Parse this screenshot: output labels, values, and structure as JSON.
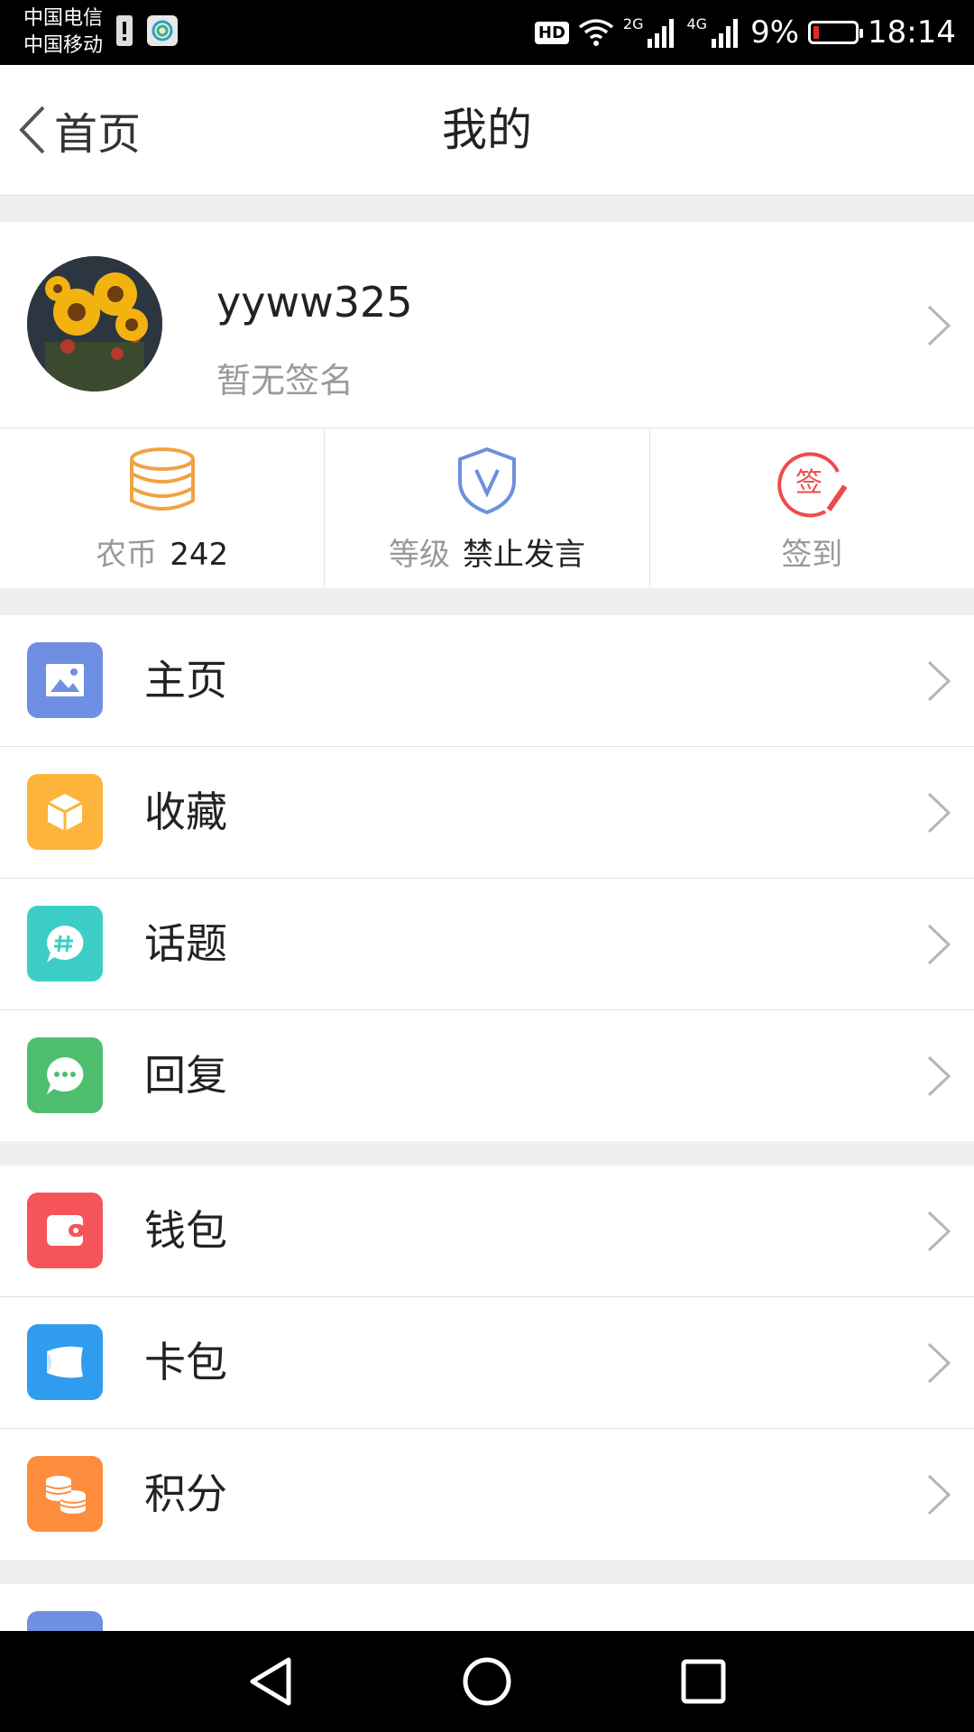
{
  "status": {
    "carrier_top": "中国电信",
    "carrier_bottom": "中国移动",
    "hd": "HD",
    "net2": "2G",
    "net4": "4G",
    "battery": "9%",
    "time": "18:14"
  },
  "header": {
    "back_label": "首页",
    "title": "我的"
  },
  "profile": {
    "username": "yyww325",
    "signature": "暂无签名"
  },
  "stats": {
    "coin_label": "农币",
    "coin_value": "242",
    "level_label": "等级",
    "level_value": "禁止发言",
    "checkin_label": "签到",
    "checkin_icon_char": "签"
  },
  "menu_group_1": [
    {
      "label": "主页",
      "color": "#6f8fe3",
      "icon": "image-icon"
    },
    {
      "label": "收藏",
      "color": "#fdb43a",
      "icon": "box-icon"
    },
    {
      "label": "话题",
      "color": "#3ccec6",
      "icon": "topic-icon"
    },
    {
      "label": "回复",
      "color": "#4fbf6f",
      "icon": "reply-icon"
    }
  ],
  "menu_group_2": [
    {
      "label": "钱包",
      "color": "#f5545a",
      "icon": "wallet-icon"
    },
    {
      "label": "卡包",
      "color": "#2f9cf0",
      "icon": "card-icon"
    },
    {
      "label": "积分",
      "color": "#fd8d3c",
      "icon": "points-icon"
    }
  ]
}
